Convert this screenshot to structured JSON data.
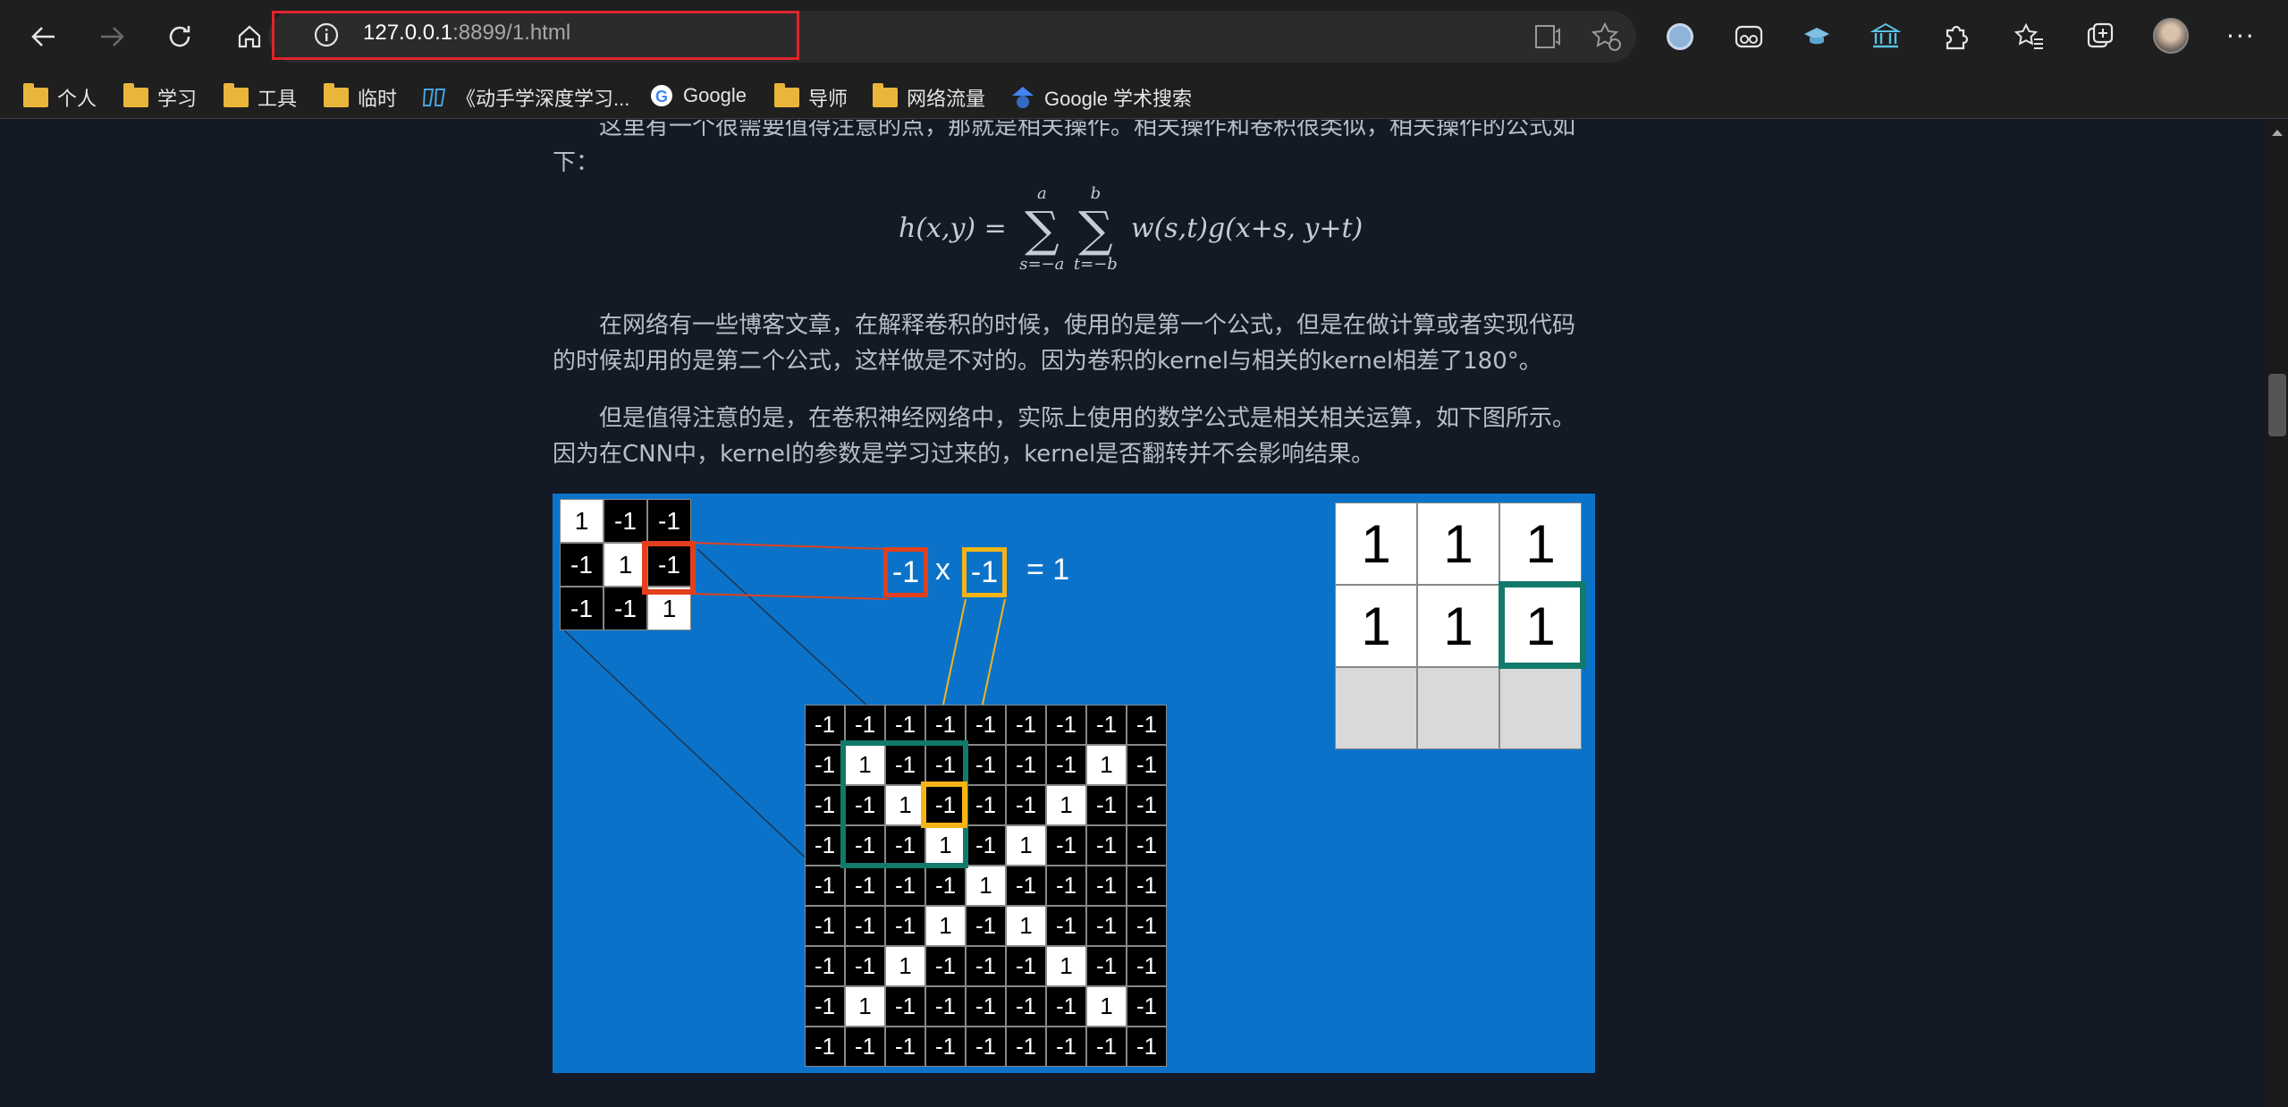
{
  "browser": {
    "url_host": "127.0.0.1",
    "url_rest": ":8899/1.html",
    "icons": [
      "back-icon",
      "forward-icon",
      "refresh-icon",
      "home-icon",
      "info-icon",
      "reader-icon",
      "favorite-add-icon",
      "circle-ext-icon",
      "mask-ext-icon",
      "hat-ext-icon",
      "bank-ext-icon",
      "extensions-icon",
      "favorites-icon",
      "collections-icon",
      "profile-avatar",
      "more-icon"
    ]
  },
  "bookmarks": [
    {
      "label": "个人",
      "icon": "folder-icon"
    },
    {
      "label": "学习",
      "icon": "folder-icon"
    },
    {
      "label": "工具",
      "icon": "folder-icon"
    },
    {
      "label": "临时",
      "icon": "folder-icon"
    },
    {
      "label": "《动手学深度学习...",
      "icon": "book-icon"
    },
    {
      "label": "Google",
      "icon": "google-icon"
    },
    {
      "label": "导师",
      "icon": "folder-icon"
    },
    {
      "label": "网络流量",
      "icon": "folder-icon"
    },
    {
      "label": "Google 学术搜索",
      "icon": "scholar-icon"
    }
  ],
  "article": {
    "para1": "这里有一个很需要值得注意的点，那就是相关操作。相关操作和卷积很类似，相关操作的公式如下：",
    "formula_lhs": "h(x,y) =",
    "formula_sum1_top": "a",
    "formula_sum1_bot": "s=−a",
    "formula_sum2_top": "b",
    "formula_sum2_bot": "t=−b",
    "formula_rhs": "w(s,t)g(x+s, y+t)",
    "sigma": "∑",
    "para2": "在网络有一些博客文章，在解释卷积的时候，使用的是第一个公式，但是在做计算或者实现代码的时候却用的是第二个公式，这样做是不对的。因为卷积的kernel与相关的kernel相差了180°。",
    "para3": "但是值得注意的是，在卷积神经网络中，实际上使用的数学公式是相关相关运算，如下图所示。因为在CNN中，kernel的参数是学习过来的，kernel是否翻转并不会影响结果。"
  },
  "figure": {
    "kernel": [
      [
        "1",
        "-1",
        "-1"
      ],
      [
        "-1",
        "1",
        "-1"
      ],
      [
        "-1",
        "-1",
        "1"
      ]
    ],
    "equation": {
      "a": "-1",
      "x": "x",
      "b": "-1",
      "eq": "= 1"
    },
    "output": [
      [
        "1",
        "1",
        "1"
      ],
      [
        "1",
        "1",
        "1"
      ],
      [
        "",
        "",
        ""
      ]
    ],
    "image": [
      [
        "-1",
        "-1",
        "-1",
        "-1",
        "-1",
        "-1",
        "-1",
        "-1",
        "-1"
      ],
      [
        "-1",
        "1",
        "-1",
        "-1",
        "-1",
        "-1",
        "-1",
        "1",
        "-1"
      ],
      [
        "-1",
        "-1",
        "1",
        "-1",
        "-1",
        "-1",
        "1",
        "-1",
        "-1"
      ],
      [
        "-1",
        "-1",
        "-1",
        "1",
        "-1",
        "1",
        "-1",
        "-1",
        "-1"
      ],
      [
        "-1",
        "-1",
        "-1",
        "-1",
        "1",
        "-1",
        "-1",
        "-1",
        "-1"
      ],
      [
        "-1",
        "-1",
        "-1",
        "1",
        "-1",
        "1",
        "-1",
        "-1",
        "-1"
      ],
      [
        "-1",
        "-1",
        "1",
        "-1",
        "-1",
        "-1",
        "1",
        "-1",
        "-1"
      ],
      [
        "-1",
        "1",
        "-1",
        "-1",
        "-1",
        "-1",
        "-1",
        "1",
        "-1"
      ],
      [
        "-1",
        "-1",
        "-1",
        "-1",
        "-1",
        "-1",
        "-1",
        "-1",
        "-1"
      ]
    ],
    "colors": {
      "background": "#0a73c9",
      "red": "#e2401c",
      "yellow": "#f5b316",
      "green": "#127a6a"
    }
  }
}
